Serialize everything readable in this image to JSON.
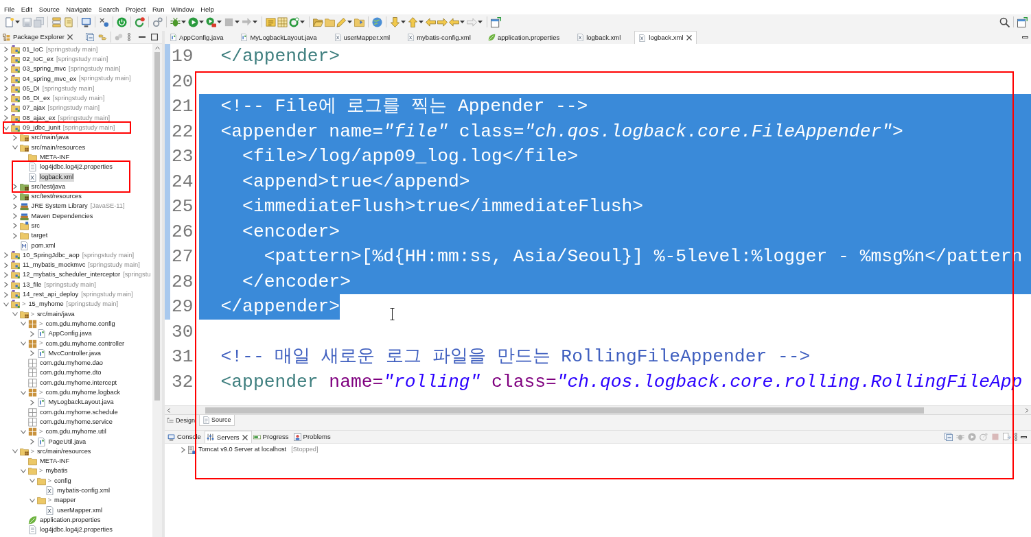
{
  "menu": [
    "File",
    "Edit",
    "Source",
    "Navigate",
    "Search",
    "Project",
    "Run",
    "Window",
    "Help"
  ],
  "explorer": {
    "title": "Package Explorer",
    "tree": [
      {
        "label": "01_IoC",
        "decoration": "[springstudy main]",
        "kind": "project",
        "expanded": false,
        "selected": false
      },
      {
        "label": "02_IoC_ex",
        "decoration": "[springstudy main]",
        "kind": "project",
        "expanded": false,
        "selected": false
      },
      {
        "label": "03_spring_mvc",
        "decoration": "[springstudy main]",
        "kind": "project",
        "expanded": false,
        "selected": false
      },
      {
        "label": "04_spring_mvc_ex",
        "decoration": "[springstudy main]",
        "kind": "project",
        "expanded": false,
        "selected": false
      },
      {
        "label": "05_DI",
        "decoration": "[springstudy main]",
        "kind": "project",
        "expanded": false,
        "selected": false
      },
      {
        "label": "06_DI_ex",
        "decoration": "[springstudy main]",
        "kind": "project",
        "expanded": false,
        "selected": false
      },
      {
        "label": "07_ajax",
        "decoration": "[springstudy main]",
        "kind": "project",
        "expanded": false,
        "selected": false
      },
      {
        "label": "08_ajax_ex",
        "decoration": "[springstudy main]",
        "kind": "project",
        "expanded": false,
        "selected": false
      },
      {
        "label": "09_jdbc_junit",
        "decoration": "[springstudy main]",
        "kind": "project",
        "expanded": true,
        "selected": false,
        "children": [
          {
            "label": "src/main/java",
            "kind": "source-folder",
            "expanded": false,
            "selected": false
          },
          {
            "label": "src/main/resources",
            "kind": "source-folder",
            "expanded": true,
            "selected": false,
            "children": [
              {
                "label": "META-INF",
                "kind": "folder",
                "selected": false
              },
              {
                "label": "log4jdbc.log4j2.properties",
                "kind": "properties-file",
                "selected": false
              },
              {
                "label": "logback.xml",
                "kind": "xml-file",
                "selected": true
              }
            ]
          },
          {
            "label": "src/test/java",
            "kind": "test-folder",
            "expanded": false,
            "selected": false
          },
          {
            "label": "src/test/resources",
            "kind": "test-folder",
            "expanded": false,
            "selected": false
          },
          {
            "label": "JRE System Library",
            "decoration": "[JavaSE-11]",
            "kind": "library",
            "expanded": false,
            "selected": false
          },
          {
            "label": "Maven Dependencies",
            "kind": "library",
            "expanded": false,
            "selected": false
          },
          {
            "label": "src",
            "kind": "project-folder",
            "expanded": false,
            "selected": false
          },
          {
            "label": "target",
            "kind": "folder",
            "expanded": false,
            "selected": false
          },
          {
            "label": "pom.xml",
            "kind": "pom-file",
            "selected": false
          }
        ]
      },
      {
        "label": "10_SpringJdbc_aop",
        "decoration": "[springstudy main]",
        "kind": "project",
        "expanded": false,
        "selected": false
      },
      {
        "label": "11_mybatis_mockmvc",
        "decoration": "[springstudy main]",
        "kind": "project",
        "expanded": false,
        "selected": false
      },
      {
        "label": "12_mybatis_scheduler_interceptor",
        "decoration": "[springstu",
        "kind": "project",
        "expanded": false,
        "selected": false
      },
      {
        "label": "13_file",
        "decoration": "[springstudy main]",
        "kind": "project",
        "expanded": false,
        "selected": false
      },
      {
        "label": "14_rest_api_deploy",
        "decoration": "[springstudy main]",
        "kind": "project",
        "expanded": false,
        "selected": false
      },
      {
        "label": "15_myhome",
        "prefix": ">",
        "decoration": "[springstudy main]",
        "kind": "project",
        "expanded": true,
        "selected": false,
        "children": [
          {
            "label": "src/main/java",
            "prefix": ">",
            "kind": "source-folder",
            "expanded": true,
            "selected": false,
            "children": [
              {
                "label": "com.gdu.myhome.config",
                "prefix": ">",
                "kind": "package",
                "expanded": true,
                "selected": false,
                "children": [
                  {
                    "label": "AppConfig.java",
                    "kind": "java-file",
                    "expanded": false,
                    "selected": false
                  }
                ]
              },
              {
                "label": "com.gdu.myhome.controller",
                "prefix": ">",
                "kind": "package",
                "expanded": true,
                "selected": false,
                "children": [
                  {
                    "label": "MvcController.java",
                    "kind": "java-file",
                    "expanded": false,
                    "selected": false
                  }
                ]
              },
              {
                "label": "com.gdu.myhome.dao",
                "kind": "empty-package",
                "selected": false
              },
              {
                "label": "com.gdu.myhome.dto",
                "kind": "empty-package",
                "selected": false
              },
              {
                "label": "com.gdu.myhome.intercept",
                "kind": "empty-package",
                "selected": false
              },
              {
                "label": "com.gdu.myhome.logback",
                "prefix": ">",
                "kind": "package",
                "expanded": true,
                "selected": false,
                "children": [
                  {
                    "label": "MyLogbackLayout.java",
                    "kind": "java-file",
                    "expanded": false,
                    "selected": false
                  }
                ]
              },
              {
                "label": "com.gdu.myhome.schedule",
                "kind": "empty-package",
                "selected": false
              },
              {
                "label": "com.gdu.myhome.service",
                "kind": "empty-package",
                "selected": false
              },
              {
                "label": "com.gdu.myhome.util",
                "prefix": ">",
                "kind": "package",
                "expanded": true,
                "selected": false,
                "children": [
                  {
                    "label": "PageUtil.java",
                    "kind": "java-file",
                    "expanded": false,
                    "selected": false
                  }
                ]
              }
            ]
          },
          {
            "label": "src/main/resources",
            "prefix": ">",
            "kind": "source-folder",
            "expanded": true,
            "selected": false,
            "children": [
              {
                "label": "META-INF",
                "kind": "folder",
                "selected": false
              },
              {
                "label": "mybatis",
                "prefix": ">",
                "kind": "folder",
                "expanded": true,
                "selected": false,
                "children": [
                  {
                    "label": "config",
                    "prefix": ">",
                    "kind": "folder",
                    "expanded": true,
                    "selected": false,
                    "children": [
                      {
                        "label": "mybatis-config.xml",
                        "kind": "xml-file",
                        "selected": false
                      }
                    ]
                  },
                  {
                    "label": "mapper",
                    "prefix": ">",
                    "kind": "folder",
                    "expanded": true,
                    "selected": false,
                    "children": [
                      {
                        "label": "userMapper.xml",
                        "kind": "xml-file",
                        "selected": false
                      }
                    ]
                  }
                ]
              },
              {
                "label": "application.properties",
                "kind": "spring-file",
                "selected": false
              },
              {
                "label": "log4jdbc.log4j2.properties",
                "kind": "properties-file",
                "selected": false
              }
            ]
          }
        ]
      }
    ]
  },
  "editor_tabs": [
    {
      "label": "AppConfig.java",
      "kind": "java-file",
      "selected": false
    },
    {
      "label": "MyLogbackLayout.java",
      "kind": "java-file",
      "selected": false
    },
    {
      "label": "userMapper.xml",
      "kind": "xml-file",
      "selected": false
    },
    {
      "label": "mybatis-config.xml",
      "kind": "xml-file",
      "selected": false
    },
    {
      "label": "application.properties",
      "kind": "spring-file",
      "selected": false
    },
    {
      "label": "logback.xml",
      "kind": "xml-file",
      "selected": false
    },
    {
      "label": "logback.xml",
      "kind": "xml-file",
      "selected": true
    }
  ],
  "editor": {
    "lines": [
      {
        "number": "19",
        "in_range": true,
        "selected": false,
        "eol_selected": false,
        "tokens": [
          {
            "kind": "tag",
            "text": "  </appender>"
          }
        ]
      },
      {
        "number": "20",
        "in_range": true,
        "selected": false,
        "eol_selected": false
      },
      {
        "number": "21",
        "in_range": true,
        "selected": true,
        "eol_selected": true,
        "tokens": [
          {
            "kind": "comment",
            "text": "  <!-- File에 로그를 찍는 Appender -->"
          }
        ]
      },
      {
        "number": "22",
        "in_range": true,
        "selected": true,
        "eol_selected": true,
        "tokens": [
          {
            "kind": "tag",
            "text": "  <appender"
          },
          {
            "kind": "attr",
            "text": " name="
          },
          {
            "kind": "value",
            "text": "\"file\""
          },
          {
            "kind": "attr",
            "text": " class="
          },
          {
            "kind": "value",
            "text": "\"ch.qos.logback.core.FileAppender\""
          },
          {
            "kind": "tag",
            "text": ">"
          }
        ]
      },
      {
        "number": "23",
        "in_range": true,
        "selected": true,
        "eol_selected": true,
        "tokens": [
          {
            "kind": "tag",
            "text": "    <file>"
          },
          {
            "kind": "text",
            "text": "/log/app09_log.log"
          },
          {
            "kind": "tag",
            "text": "</file>"
          }
        ]
      },
      {
        "number": "24",
        "in_range": true,
        "selected": true,
        "eol_selected": true,
        "tokens": [
          {
            "kind": "tag",
            "text": "    <append>"
          },
          {
            "kind": "text",
            "text": "true"
          },
          {
            "kind": "tag",
            "text": "</append>"
          }
        ]
      },
      {
        "number": "25",
        "in_range": true,
        "selected": true,
        "eol_selected": true,
        "tokens": [
          {
            "kind": "tag",
            "text": "    <immediateFlush>"
          },
          {
            "kind": "text",
            "text": "true"
          },
          {
            "kind": "tag",
            "text": "</immediateFlush>"
          }
        ]
      },
      {
        "number": "26",
        "in_range": true,
        "selected": true,
        "eol_selected": true,
        "tokens": [
          {
            "kind": "tag",
            "text": "    <encoder>"
          }
        ]
      },
      {
        "number": "27",
        "in_range": true,
        "selected": true,
        "eol_selected": true,
        "tokens": [
          {
            "kind": "tag",
            "text": "      <pattern>"
          },
          {
            "kind": "text",
            "text": "[%d{HH:mm:ss, Asia/Seoul}] %-5level:%logger - %msg%n"
          },
          {
            "kind": "tag",
            "text": "</pattern"
          }
        ]
      },
      {
        "number": "28",
        "in_range": true,
        "selected": true,
        "eol_selected": true,
        "tokens": [
          {
            "kind": "tag",
            "text": "    </encoder>"
          }
        ]
      },
      {
        "number": "29",
        "in_range": true,
        "selected": true,
        "eol_selected": false,
        "tokens": [
          {
            "kind": "tag",
            "text": "  </appender>"
          }
        ]
      },
      {
        "number": "30",
        "in_range": false,
        "selected": false,
        "eol_selected": false
      },
      {
        "number": "31",
        "in_range": false,
        "selected": false,
        "eol_selected": false,
        "tokens": [
          {
            "kind": "comment",
            "text": "  <!-- 매일 새로운 로그 파일을 만드는 RollingFileAppender -->"
          }
        ]
      },
      {
        "number": "32",
        "in_range": false,
        "selected": false,
        "eol_selected": false,
        "tokens": [
          {
            "kind": "tag",
            "text": "  <appender"
          },
          {
            "kind": "attr",
            "text": " name="
          },
          {
            "kind": "value",
            "text": "\"rolling\""
          },
          {
            "kind": "attr",
            "text": " class="
          },
          {
            "kind": "value",
            "text": "\"ch.qos.logback.core.rolling.RollingFileApp"
          }
        ]
      }
    ]
  },
  "editor_mode_tabs": [
    {
      "label": "Design",
      "kind": "design",
      "selected": false
    },
    {
      "label": "Source",
      "kind": "source",
      "selected": true
    }
  ],
  "bottom_tabs": [
    {
      "label": "Console",
      "kind": "console",
      "selected": false
    },
    {
      "label": "Servers",
      "kind": "servers",
      "selected": true
    },
    {
      "label": "Progress",
      "kind": "progress",
      "selected": false
    },
    {
      "label": "Problems",
      "kind": "problems",
      "selected": false
    }
  ],
  "servers": [
    {
      "name": "Tomcat v9.0 Server at localhost",
      "state": "[Stopped]",
      "expanded": false
    }
  ]
}
